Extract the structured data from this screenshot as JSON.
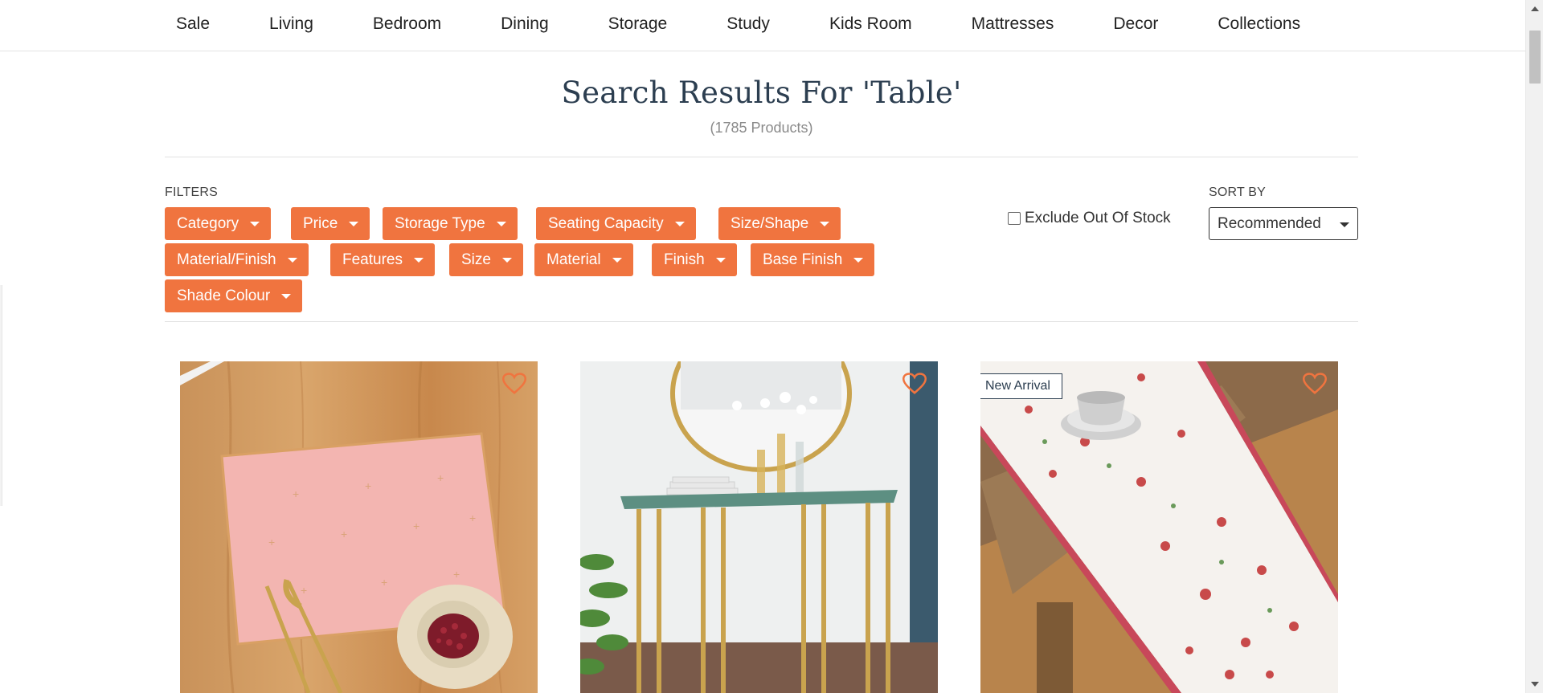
{
  "nav": {
    "items": [
      "Sale",
      "Living",
      "Bedroom",
      "Dining",
      "Storage",
      "Study",
      "Kids Room",
      "Mattresses",
      "Decor",
      "Collections"
    ]
  },
  "search": {
    "title": "Search Results For 'Table'",
    "count": "(1785 Products)"
  },
  "filters": {
    "label": "FILTERS",
    "chips": [
      "Category",
      "Price",
      "Storage Type",
      "Seating Capacity",
      "Size/Shape",
      "Material/Finish",
      "Features",
      "Size",
      "Material",
      "Finish",
      "Base Finish",
      "Shade Colour"
    ]
  },
  "stock": {
    "label": "Exclude Out Of Stock",
    "checked": false
  },
  "sort": {
    "label": "SORT BY",
    "selected": "Recommended"
  },
  "products": [
    {
      "image": "pink-placemat-with-fork-knife-and-bowl",
      "wishlist_icon": "heart-icon",
      "badge": ""
    },
    {
      "image": "glass-top-gold-console-table-with-mirror",
      "wishlist_icon": "heart-icon",
      "badge": ""
    },
    {
      "image": "floral-table-runner-on-wooden-table",
      "wishlist_icon": "heart-icon",
      "badge": "New Arrival"
    }
  ],
  "colors": {
    "accent": "#f0743f",
    "heading": "#2c3e50"
  }
}
